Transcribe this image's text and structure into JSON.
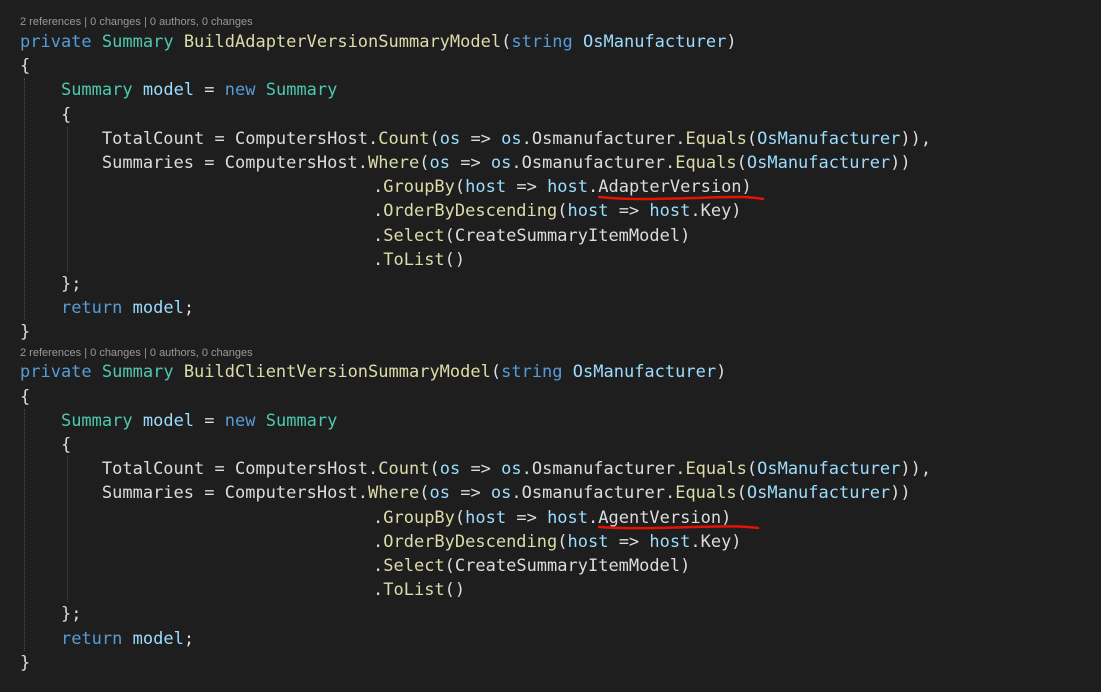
{
  "accent": {
    "keyword": "#569cd6",
    "type": "#4ec9b0",
    "method": "#dcdcaa",
    "param": "#9cdcfe",
    "text": "#dcdcdc",
    "codelens": "#999999",
    "error": "#e51400"
  },
  "blocks": [
    {
      "codelens": {
        "refs": "2 references",
        "changes": "0 changes",
        "authors": "0 authors, 0 changes"
      },
      "sig": {
        "kw": "private",
        "type": "Summary",
        "name": "BuildAdapterVersionSummaryModel",
        "open": "(",
        "ptype": "string",
        "pname": "OsManufacturer",
        "close": ")"
      },
      "brace_open": "{",
      "decl": {
        "type": "Summary",
        "var": "model",
        "eq": " = ",
        "kw": "new",
        "type2": "Summary"
      },
      "init_open": "{",
      "total": {
        "prop": "TotalCount",
        "eq": " = ",
        "host": "ComputersHost",
        "dot": ".",
        "method": "Count",
        "p1": "(",
        "os": "os",
        "arrow": " => ",
        "os2": "os",
        "dot2": ".",
        "member": "Osmanufacturer",
        "dot3": ".",
        "eqm": "Equals",
        "p2": "(",
        "arg": "OsManufacturer",
        "p3": ")),"
      },
      "summ": {
        "prop": "Summaries",
        "eq": " = ",
        "host": "ComputersHost",
        "dot": ".",
        "method": "Where",
        "p1": "(",
        "os": "os",
        "arrow": " => ",
        "os2": "os",
        "dot2": ".",
        "member": "Osmanufacturer",
        "dot3": ".",
        "eqm": "Equals",
        "p2": "(",
        "arg": "OsManufacturer",
        "p3": "))"
      },
      "groupby": {
        "dot": ".",
        "method": "GroupBy",
        "p1": "(",
        "h": "host",
        "arrow": " => ",
        "h2": "host",
        "member": ".AdapterVersion)"
      },
      "orderby": {
        "dot": ".",
        "method": "OrderByDescending",
        "p1": "(",
        "h": "host",
        "arrow": " => ",
        "h2": "host",
        "member": ".Key)"
      },
      "select": {
        "dot": ".",
        "method": "Select",
        "p1": "(",
        "arg": "CreateSummaryItemModel",
        "p2": ")"
      },
      "tolist": {
        "dot": ".",
        "method": "ToList",
        "p": "()"
      },
      "init_close": "};",
      "ret": {
        "kw": "return",
        "var": "model",
        "semi": ";"
      },
      "brace_close": "}"
    },
    {
      "codelens": {
        "refs": "2 references",
        "changes": "0 changes",
        "authors": "0 authors, 0 changes"
      },
      "sig": {
        "kw": "private",
        "type": "Summary",
        "name": "BuildClientVersionSummaryModel",
        "open": "(",
        "ptype": "string",
        "pname": "OsManufacturer",
        "close": ")"
      },
      "brace_open": "{",
      "decl": {
        "type": "Summary",
        "var": "model",
        "eq": " = ",
        "kw": "new",
        "type2": "Summary"
      },
      "init_open": "{",
      "total": {
        "prop": "TotalCount",
        "eq": " = ",
        "host": "ComputersHost",
        "dot": ".",
        "method": "Count",
        "p1": "(",
        "os": "os",
        "arrow": " => ",
        "os2": "os",
        "dot2": ".",
        "member": "Osmanufacturer",
        "dot3": ".",
        "eqm": "Equals",
        "p2": "(",
        "arg": "OsManufacturer",
        "p3": ")),"
      },
      "summ": {
        "prop": "Summaries",
        "eq": " = ",
        "host": "ComputersHost",
        "dot": ".",
        "method": "Where",
        "p1": "(",
        "os": "os",
        "arrow": " => ",
        "os2": "os",
        "dot2": ".",
        "member": "Osmanufacturer",
        "dot3": ".",
        "eqm": "Equals",
        "p2": "(",
        "arg": "OsManufacturer",
        "p3": "))"
      },
      "groupby": {
        "dot": ".",
        "method": "GroupBy",
        "p1": "(",
        "h": "host",
        "arrow": " => ",
        "h2": "host",
        "member": ".AgentVersion)"
      },
      "orderby": {
        "dot": ".",
        "method": "OrderByDescending",
        "p1": "(",
        "h": "host",
        "arrow": " => ",
        "h2": "host",
        "member": ".Key)"
      },
      "select": {
        "dot": ".",
        "method": "Select",
        "p1": "(",
        "arg": "CreateSummaryItemModel",
        "p2": ")"
      },
      "tolist": {
        "dot": ".",
        "method": "ToList",
        "p": "()"
      },
      "init_close": "};",
      "ret": {
        "kw": "return",
        "var": "model",
        "semi": ";"
      },
      "brace_close": "}"
    }
  ]
}
